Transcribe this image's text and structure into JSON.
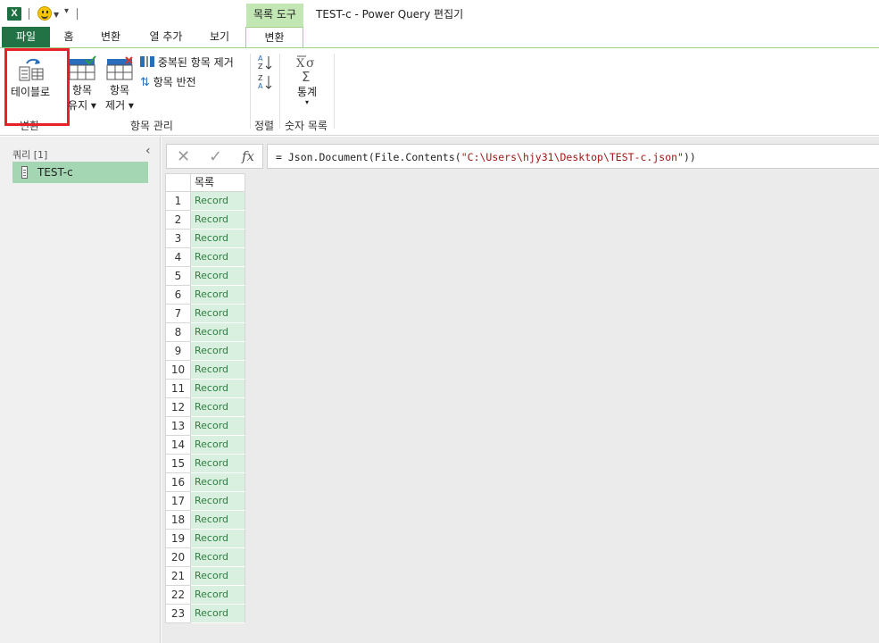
{
  "window": {
    "title": "TEST-c - Power Query 편집기",
    "context_tab_group": "목록 도구"
  },
  "qat": {
    "excel_icon_letter": "X",
    "menu_glyph": "▾"
  },
  "tabs": [
    {
      "label": "파일",
      "kind": "file"
    },
    {
      "label": "홈"
    },
    {
      "label": "변환"
    },
    {
      "label": "열 추가"
    },
    {
      "label": "보기"
    },
    {
      "label": "변환",
      "active": true
    }
  ],
  "ribbon": {
    "to_table": {
      "label": "테이블로",
      "group": "변환"
    },
    "keep_items": {
      "line1": "항목",
      "line2": "유지 ▾"
    },
    "remove_items": {
      "line1": "항목",
      "line2": "제거 ▾"
    },
    "remove_duplicates": "중복된 항목 제거",
    "reverse_items": "항목 반전",
    "manage_group": "항목 관리",
    "sort_group": "정렬",
    "stats": {
      "label": "통계",
      "caret": "▾"
    },
    "numeric_group": "숫자 목록"
  },
  "queries": {
    "header": "쿼리 [1]",
    "items": [
      {
        "label": "TEST-c"
      }
    ]
  },
  "formula": {
    "prefix": "= Json.Document(File.Contents(",
    "string": "\"C:\\Users\\hjy31\\Desktop\\TEST-c.json\"",
    "suffix": "))",
    "cancel": "✕",
    "confirm": "✓",
    "fx": "fx"
  },
  "table": {
    "column": "목록",
    "rows": [
      "Record",
      "Record",
      "Record",
      "Record",
      "Record",
      "Record",
      "Record",
      "Record",
      "Record",
      "Record",
      "Record",
      "Record",
      "Record",
      "Record",
      "Record",
      "Record",
      "Record",
      "Record",
      "Record",
      "Record",
      "Record",
      "Record",
      "Record"
    ]
  }
}
